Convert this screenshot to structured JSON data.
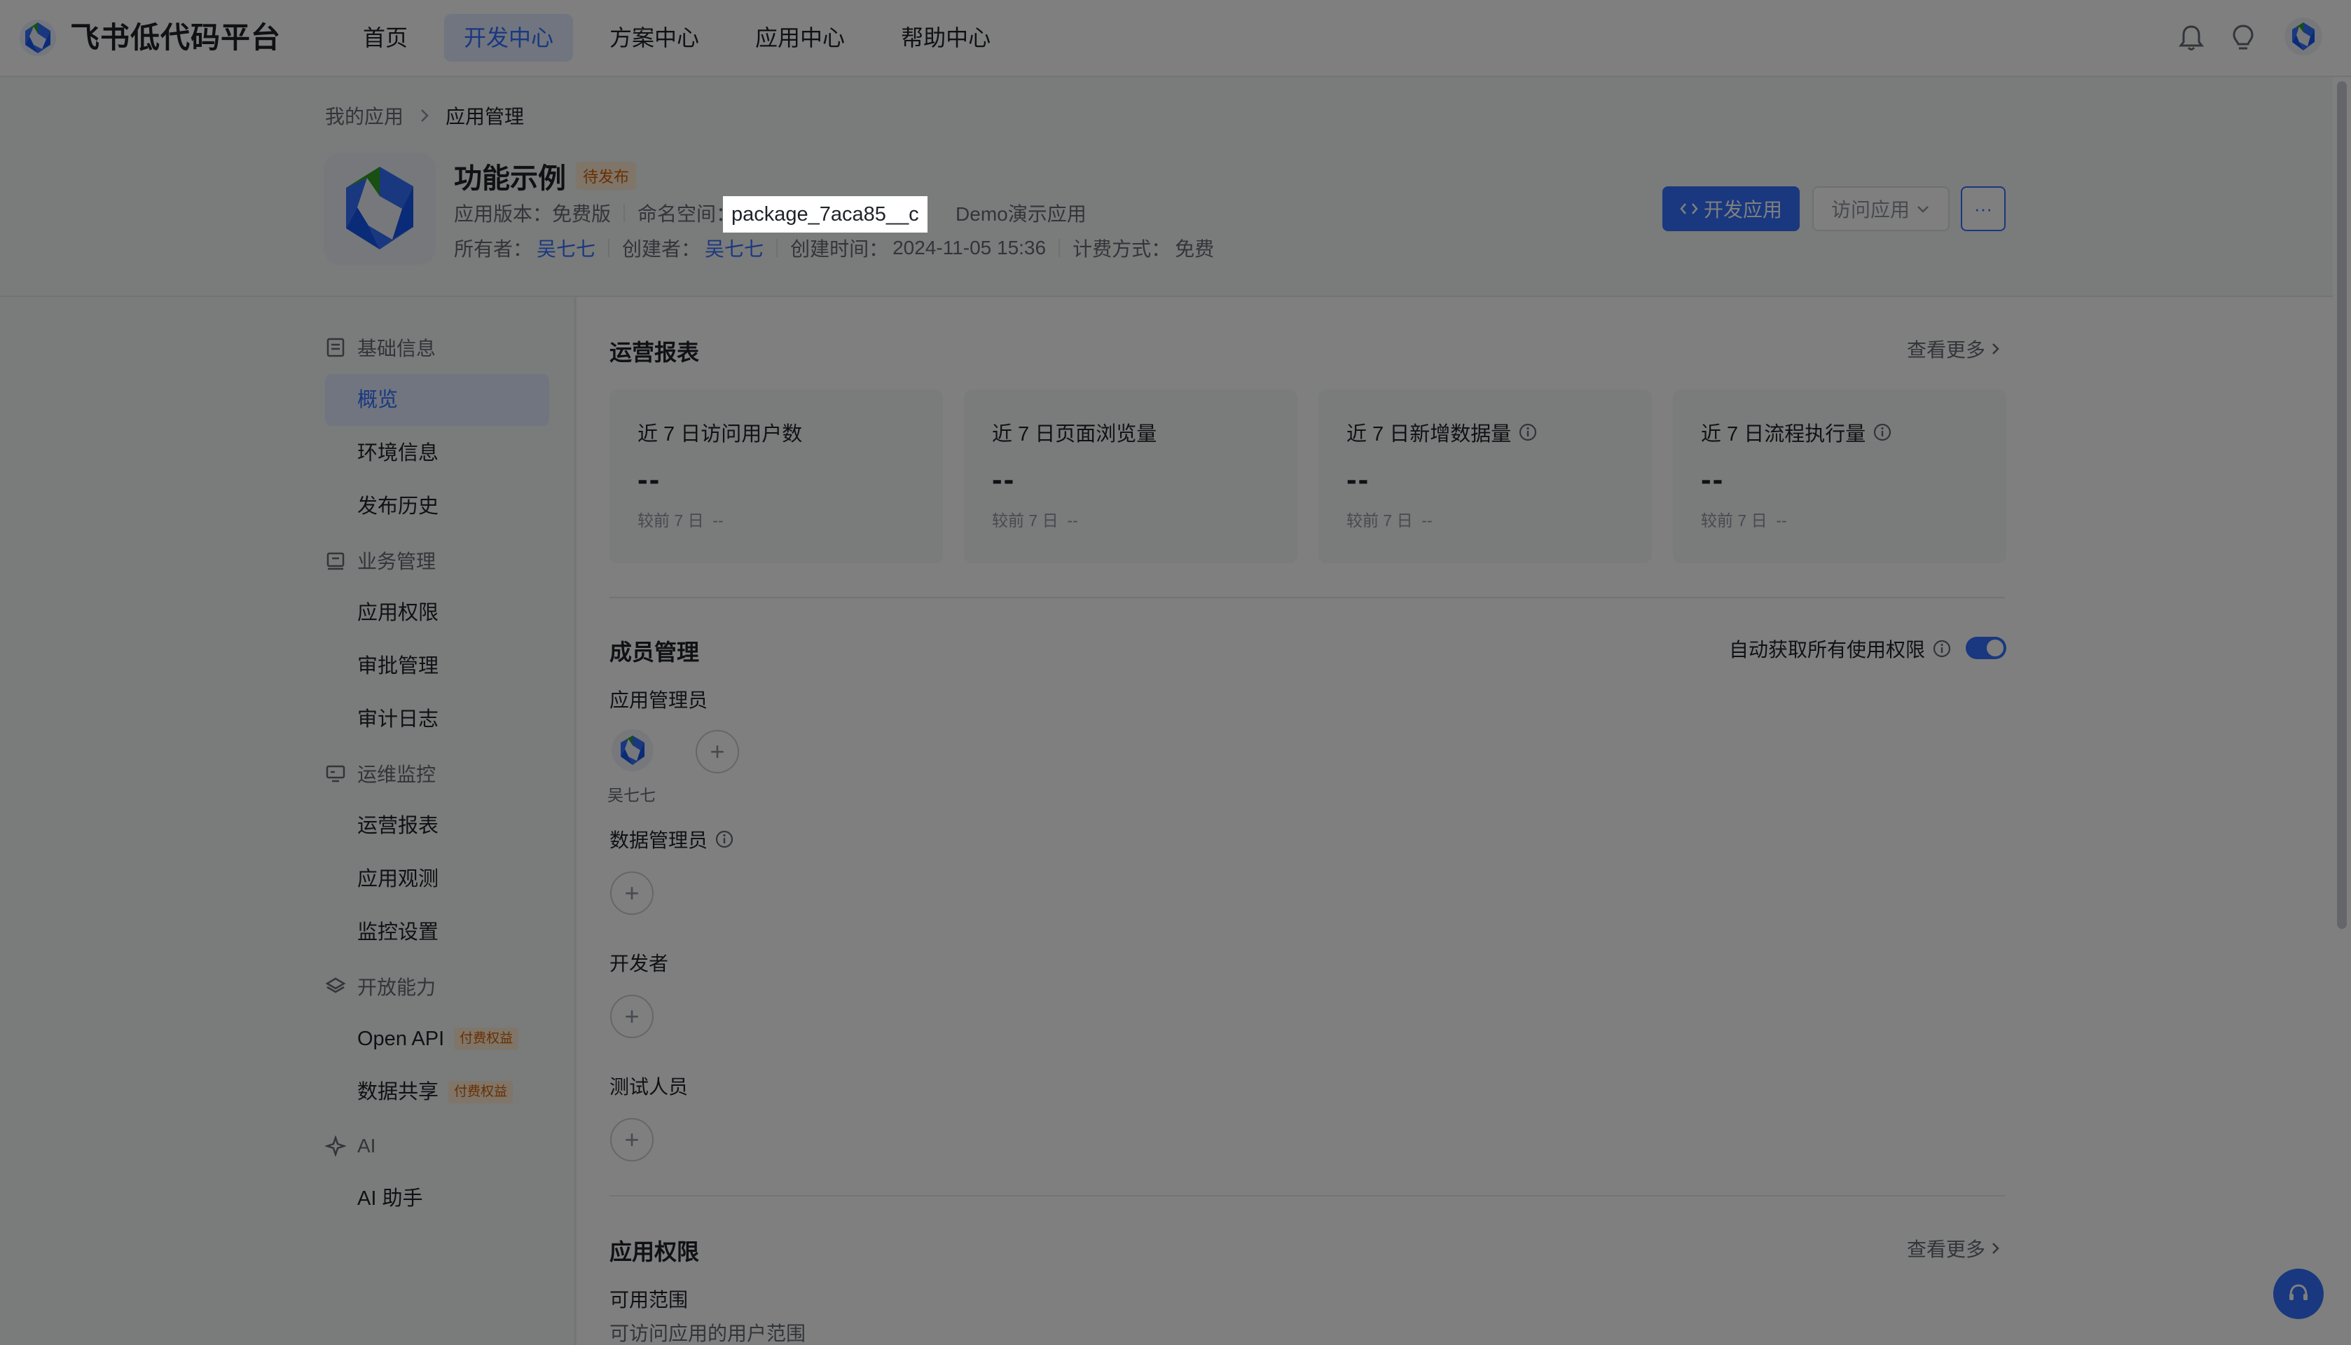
{
  "topbar": {
    "brand": "飞书低代码平台",
    "nav": [
      {
        "label": "首页",
        "active": false
      },
      {
        "label": "开发中心",
        "active": true
      },
      {
        "label": "方案中心",
        "active": false
      },
      {
        "label": "应用中心",
        "active": false
      },
      {
        "label": "帮助中心",
        "active": false
      }
    ],
    "icons": [
      "bell-icon",
      "lightbulb-icon",
      "user-avatar"
    ]
  },
  "breadcrumb": {
    "parent": "我的应用",
    "current": "应用管理"
  },
  "app": {
    "name": "功能示例",
    "status": "待发布",
    "version_label": "应用版本：",
    "version": "免费版",
    "namespace_label": "命名空间：",
    "namespace": "package_7aca85__c",
    "description": "Demo演示应用",
    "owner_label": "所有者：",
    "owner": "吴七七",
    "creator_label": "创建者：",
    "creator": "吴七七",
    "created_label": "创建时间：",
    "created": "2024-11-05 15:36",
    "billing_label": "计费方式：",
    "billing": "免费"
  },
  "actions": {
    "develop": "开发应用",
    "visit": "访问应用",
    "more": "···"
  },
  "sidebar": {
    "groups": [
      {
        "label": "基础信息",
        "icon": "document-icon",
        "items": [
          "概览",
          "环境信息",
          "发布历史"
        ]
      },
      {
        "label": "业务管理",
        "icon": "briefcase-icon",
        "items": [
          "应用权限",
          "审批管理",
          "审计日志"
        ]
      },
      {
        "label": "运维监控",
        "icon": "monitor-icon",
        "items": [
          "运营报表",
          "应用观测",
          "监控设置"
        ]
      },
      {
        "label": "开放能力",
        "icon": "layers-icon",
        "items": [
          "Open API",
          "数据共享"
        ]
      },
      {
        "label": "AI",
        "icon": "sparkle-icon",
        "items": [
          "AI 助手"
        ]
      }
    ],
    "active_item": "概览",
    "paid_badge": "付费权益"
  },
  "report": {
    "title": "运营报表",
    "see_more": "查看更多",
    "cards": [
      {
        "title": "近 7 日访问用户数",
        "value": "--",
        "compare": "较前 7 日",
        "compare_value": "--",
        "info": false
      },
      {
        "title": "近 7 日页面浏览量",
        "value": "--",
        "compare": "较前 7 日",
        "compare_value": "--",
        "info": false
      },
      {
        "title": "近 7 日新增数据量",
        "value": "--",
        "compare": "较前 7 日",
        "compare_value": "--",
        "info": true
      },
      {
        "title": "近 7 日流程执行量",
        "value": "--",
        "compare": "较前 7 日",
        "compare_value": "--",
        "info": true
      }
    ]
  },
  "members": {
    "title": "成员管理",
    "auto_permission_label": "自动获取所有使用权限",
    "auto_permission_on": true,
    "admins_label": "应用管理员",
    "admin_name": "吴七七",
    "data_admins_label": "数据管理员",
    "developers_label": "开发者",
    "testers_label": "测试人员"
  },
  "permissions": {
    "title": "应用权限",
    "see_more": "查看更多",
    "scope_label": "可用范围",
    "scope_desc": "可访问应用的用户范围"
  },
  "colors": {
    "primary": "#3370ff",
    "pending": "#d25f00",
    "overlay": "rgba(0,0,0,0.5)"
  }
}
